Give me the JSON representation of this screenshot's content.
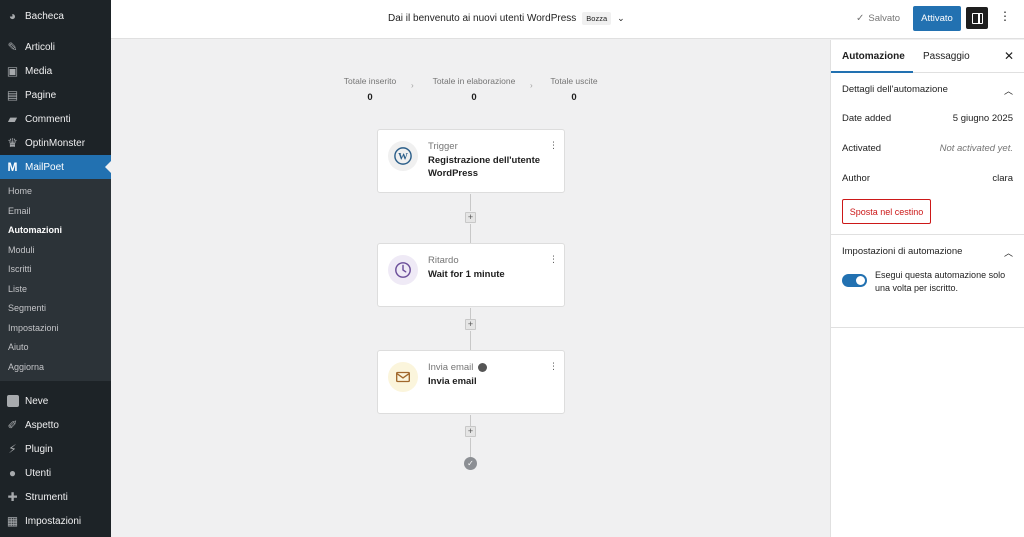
{
  "sidebar": {
    "items_top": [
      {
        "label": "Bacheca",
        "icon": "dashboard-icon"
      },
      {
        "label": "Articoli",
        "icon": "pin-icon"
      },
      {
        "label": "Media",
        "icon": "media-icon"
      },
      {
        "label": "Pagine",
        "icon": "page-icon"
      },
      {
        "label": "Commenti",
        "icon": "comment-icon"
      },
      {
        "label": "OptinMonster",
        "icon": "optinmonster-icon"
      },
      {
        "label": "MailPoet",
        "icon": "mailpoet-icon"
      }
    ],
    "submenu": [
      "Home",
      "Email",
      "Automazioni",
      "Moduli",
      "Iscritti",
      "Liste",
      "Segmenti",
      "Impostazioni",
      "Aiuto",
      "Aggiorna"
    ],
    "items_bottom": [
      {
        "label": "Neve",
        "icon": "neve-icon"
      },
      {
        "label": "Aspetto",
        "icon": "brush-icon"
      },
      {
        "label": "Plugin",
        "icon": "plugin-icon"
      },
      {
        "label": "Utenti",
        "icon": "user-icon"
      },
      {
        "label": "Strumenti",
        "icon": "wrench-icon"
      },
      {
        "label": "Impostazioni",
        "icon": "settings-icon"
      }
    ]
  },
  "header": {
    "title": "Dai il benvenuto ai nuovi utenti WordPress",
    "status_badge": "Bozza",
    "saved_label": "Salvato",
    "activate_label": "Attivato"
  },
  "stats": [
    {
      "label": "Totale inserito",
      "value": "0"
    },
    {
      "label": "Totale in elaborazione",
      "value": "0"
    },
    {
      "label": "Totale uscite",
      "value": "0"
    }
  ],
  "steps": [
    {
      "category": "Trigger",
      "title": "Registrazione dell'utente WordPress",
      "icon": "wordpress-icon"
    },
    {
      "category": "Ritardo",
      "title": "Wait for 1 minute",
      "icon": "clock-icon"
    },
    {
      "category": "Invia email",
      "title": "Invia email",
      "icon": "envelope-icon"
    }
  ],
  "panel": {
    "tabs": [
      "Automazione",
      "Passaggio"
    ],
    "details_title": "Dettagli dell'automazione",
    "details": [
      {
        "label": "Date added",
        "value": "5 giugno 2025"
      },
      {
        "label": "Activated",
        "value": "Not activated yet."
      },
      {
        "label": "Author",
        "value": "clara"
      }
    ],
    "trash_label": "Sposta nel cestino",
    "settings_title": "Impostazioni di automazione",
    "toggle_label": "Esegui questa automazione solo una volta per iscritto.",
    "toggle_on": true
  },
  "colors": {
    "accent": "#2271b1",
    "sidebar_bg": "#1d2327",
    "danger": "#cc1818"
  }
}
